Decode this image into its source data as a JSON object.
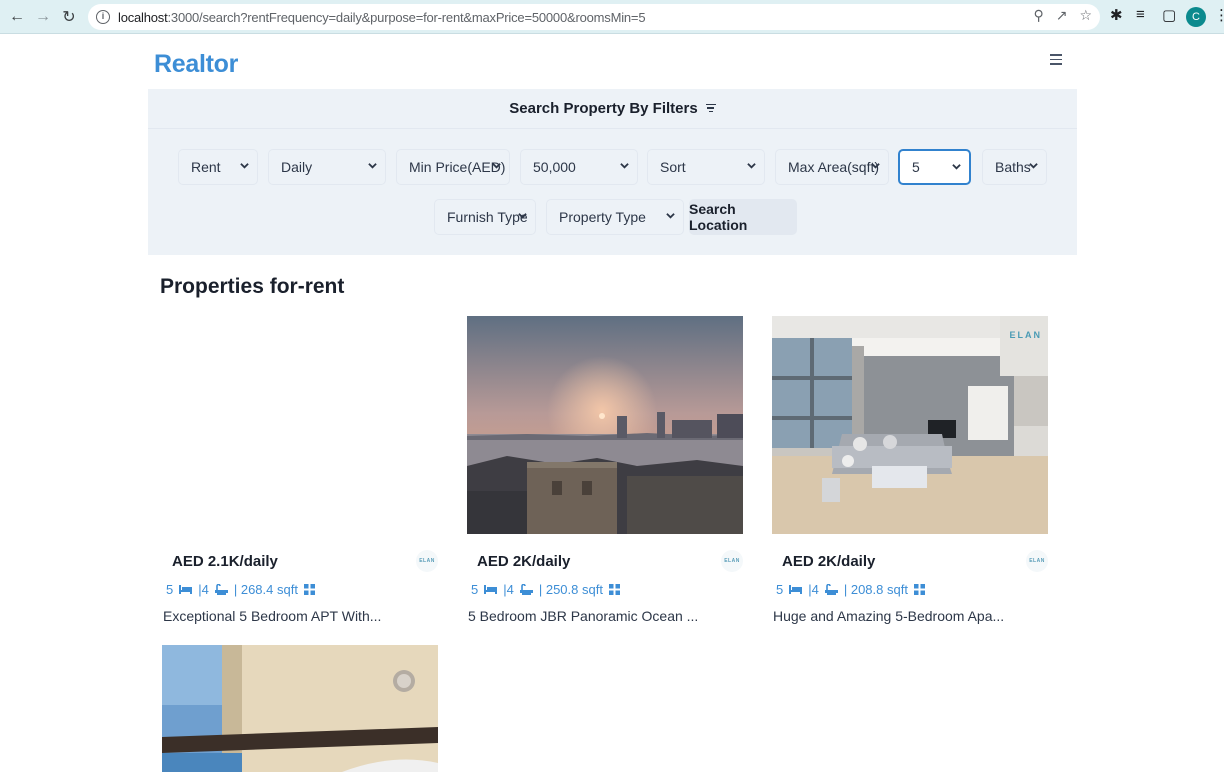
{
  "browser": {
    "url_host": "localhost",
    "url_rest": ":3000/search?rentFrequency=daily&purpose=for-rent&maxPrice=50000&roomsMin=5",
    "profile_initial": "C"
  },
  "header": {
    "brand": "Realtor"
  },
  "filters": {
    "heading": "Search Property By Filters",
    "selects": [
      {
        "label": "Rent"
      },
      {
        "label": "Daily"
      },
      {
        "label": "Min Price(AED)"
      },
      {
        "label": "50,000"
      },
      {
        "label": "Sort"
      },
      {
        "label": "Max Area(sqft)"
      },
      {
        "label": "5"
      },
      {
        "label": "Baths"
      }
    ],
    "row2": [
      {
        "label": "Furnish Type"
      },
      {
        "label": "Property Type"
      }
    ],
    "search_location": "Search Location"
  },
  "section_title": "Properties for-rent",
  "listings": [
    {
      "price": "AED 2.1K/daily",
      "rooms": "5",
      "baths": "|4",
      "area": "| 268.4 sqft",
      "title": "Exceptional 5 Bedroom APT With...",
      "agency_logo": "ELAN"
    },
    {
      "price": "AED 2K/daily",
      "rooms": "5",
      "baths": "|4",
      "area": "| 250.8 sqft",
      "title": "5 Bedroom JBR Panoramic Ocean ...",
      "agency_logo": "ELAN"
    },
    {
      "price": "AED 2K/daily",
      "rooms": "5",
      "baths": "|4",
      "area": "| 208.8 sqft",
      "title": "Huge and Amazing 5-Bedroom Apa...",
      "agency_logo": "ELAN"
    }
  ],
  "colors": {
    "accent": "#3d8ed6",
    "panel": "#edf2f7",
    "focus": "#3182ce"
  }
}
